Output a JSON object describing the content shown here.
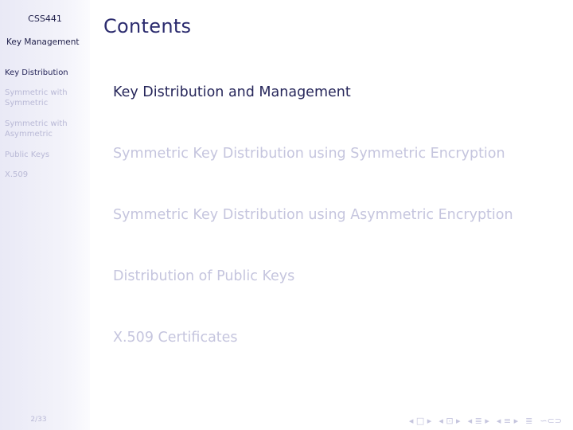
{
  "sidebar": {
    "course": "CSS441",
    "subtitle": "Key Management",
    "items": [
      {
        "label": "Key Distribution"
      },
      {
        "label": "Symmetric with Symmetric"
      },
      {
        "label": "Symmetric with Asymmetric"
      },
      {
        "label": "Public Keys"
      },
      {
        "label": "X.509"
      }
    ],
    "page": "2/33"
  },
  "slide": {
    "title": "Contents",
    "items": [
      {
        "label": "Key Distribution and Management"
      },
      {
        "label": "Symmetric Key Distribution using Symmetric Encryption"
      },
      {
        "label": "Symmetric Key Distribution using Asymmetric Encryption"
      },
      {
        "label": "Distribution of Public Keys"
      },
      {
        "label": "X.509 Certificates"
      }
    ]
  },
  "nav": {
    "first": "◂ □ ▸",
    "frame": "◂ ⊡ ▸",
    "section": "◂ ≣ ▸",
    "subsection": "◂ ≡ ▸",
    "align": "≣",
    "search": "∽⊂⊃"
  }
}
